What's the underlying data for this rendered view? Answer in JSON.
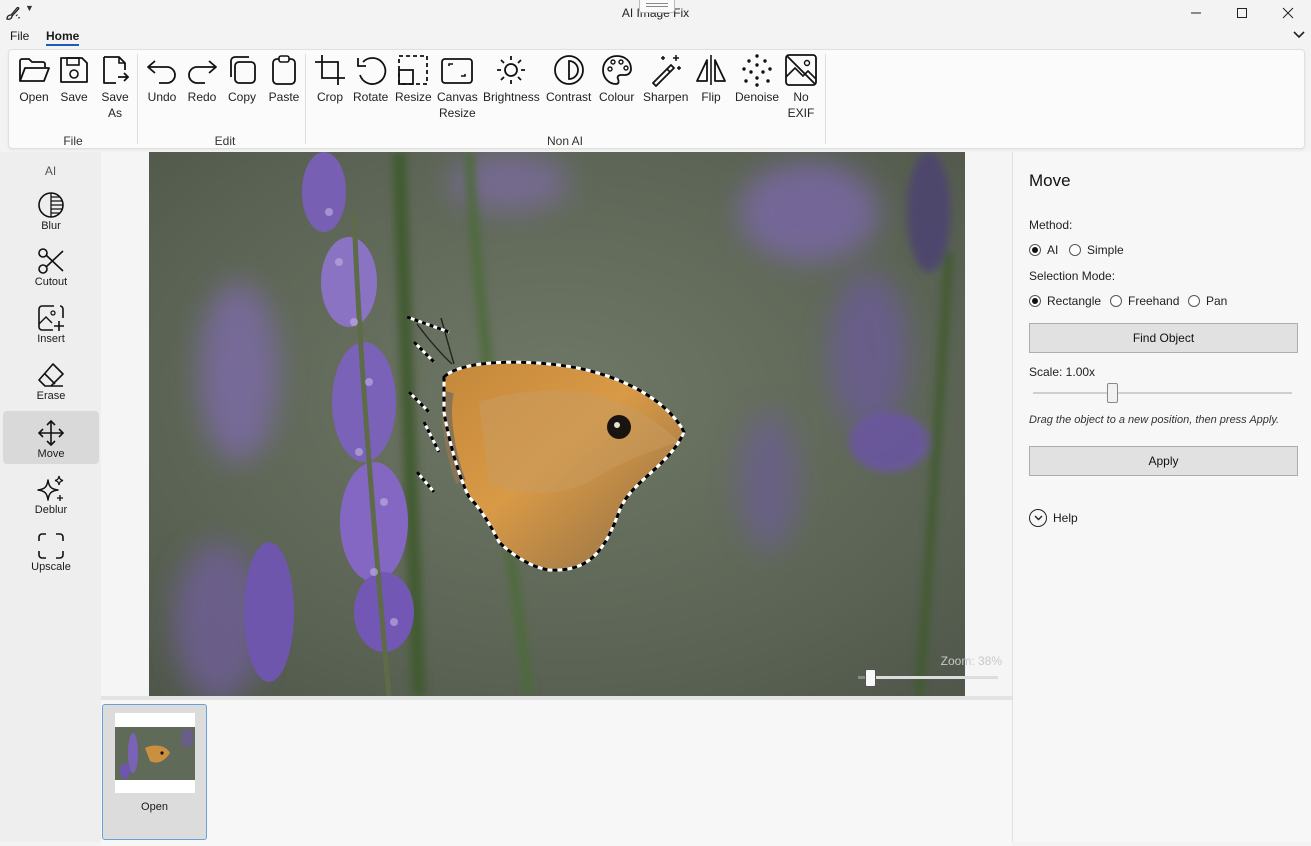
{
  "window": {
    "title": "AI Image Fix",
    "controls": {
      "minimize": "minimize-icon",
      "maximize": "maximize-icon",
      "close": "close-icon"
    }
  },
  "menu": {
    "tabs": [
      "File",
      "Home"
    ],
    "active": "Home"
  },
  "ribbon": {
    "groups": [
      {
        "label": "File",
        "buttons": [
          {
            "label": "Open",
            "icon": "folder-open-icon"
          },
          {
            "label": "Save",
            "icon": "save-icon"
          },
          {
            "label": "Save\nAs",
            "icon": "save-as-icon"
          }
        ]
      },
      {
        "label": "Edit",
        "buttons": [
          {
            "label": "Undo",
            "icon": "undo-icon"
          },
          {
            "label": "Redo",
            "icon": "redo-icon"
          },
          {
            "label": "Copy",
            "icon": "copy-icon"
          },
          {
            "label": "Paste",
            "icon": "paste-icon"
          }
        ]
      },
      {
        "label": "Non AI",
        "buttons": [
          {
            "label": "Crop",
            "icon": "crop-icon"
          },
          {
            "label": "Rotate",
            "icon": "rotate-icon"
          },
          {
            "label": "Resize",
            "icon": "resize-icon"
          },
          {
            "label": "Canvas\nResize",
            "icon": "canvas-resize-icon"
          },
          {
            "label": "Brightness",
            "icon": "brightness-icon"
          },
          {
            "label": "Contrast",
            "icon": "contrast-icon"
          },
          {
            "label": "Colour",
            "icon": "palette-icon"
          },
          {
            "label": "Sharpen",
            "icon": "magic-wand-icon"
          },
          {
            "label": "Flip",
            "icon": "flip-icon"
          },
          {
            "label": "Denoise",
            "icon": "denoise-icon"
          },
          {
            "label": "No\nEXIF",
            "icon": "no-exif-icon"
          }
        ]
      }
    ]
  },
  "ai_panel": {
    "title": "AI",
    "tools": [
      {
        "label": "Blur",
        "icon": "blur-icon"
      },
      {
        "label": "Cutout",
        "icon": "scissors-icon"
      },
      {
        "label": "Insert",
        "icon": "insert-image-icon"
      },
      {
        "label": "Erase",
        "icon": "eraser-icon"
      },
      {
        "label": "Move",
        "icon": "move-icon"
      },
      {
        "label": "Deblur",
        "icon": "sparkle-icon"
      },
      {
        "label": "Upscale",
        "icon": "upscale-icon"
      }
    ],
    "active": "Move"
  },
  "canvas": {
    "zoom_text": "Zoom: 38%",
    "zoom_percent": 38
  },
  "filmstrip": {
    "items": [
      {
        "label": "Open"
      }
    ]
  },
  "properties": {
    "title": "Move",
    "method_label": "Method:",
    "method_options": [
      "AI",
      "Simple"
    ],
    "method_selected": "AI",
    "selection_label": "Selection Mode:",
    "selection_options": [
      "Rectangle",
      "Freehand",
      "Pan"
    ],
    "selection_selected": "Rectangle",
    "find_button": "Find Object",
    "scale_label": "Scale: 1.00x",
    "scale_fraction": 0.3,
    "hint": "Drag the object to a new position, then press Apply.",
    "apply_button": "Apply",
    "help_label": "Help"
  },
  "colors": {
    "accent": "#1e5bb8"
  }
}
